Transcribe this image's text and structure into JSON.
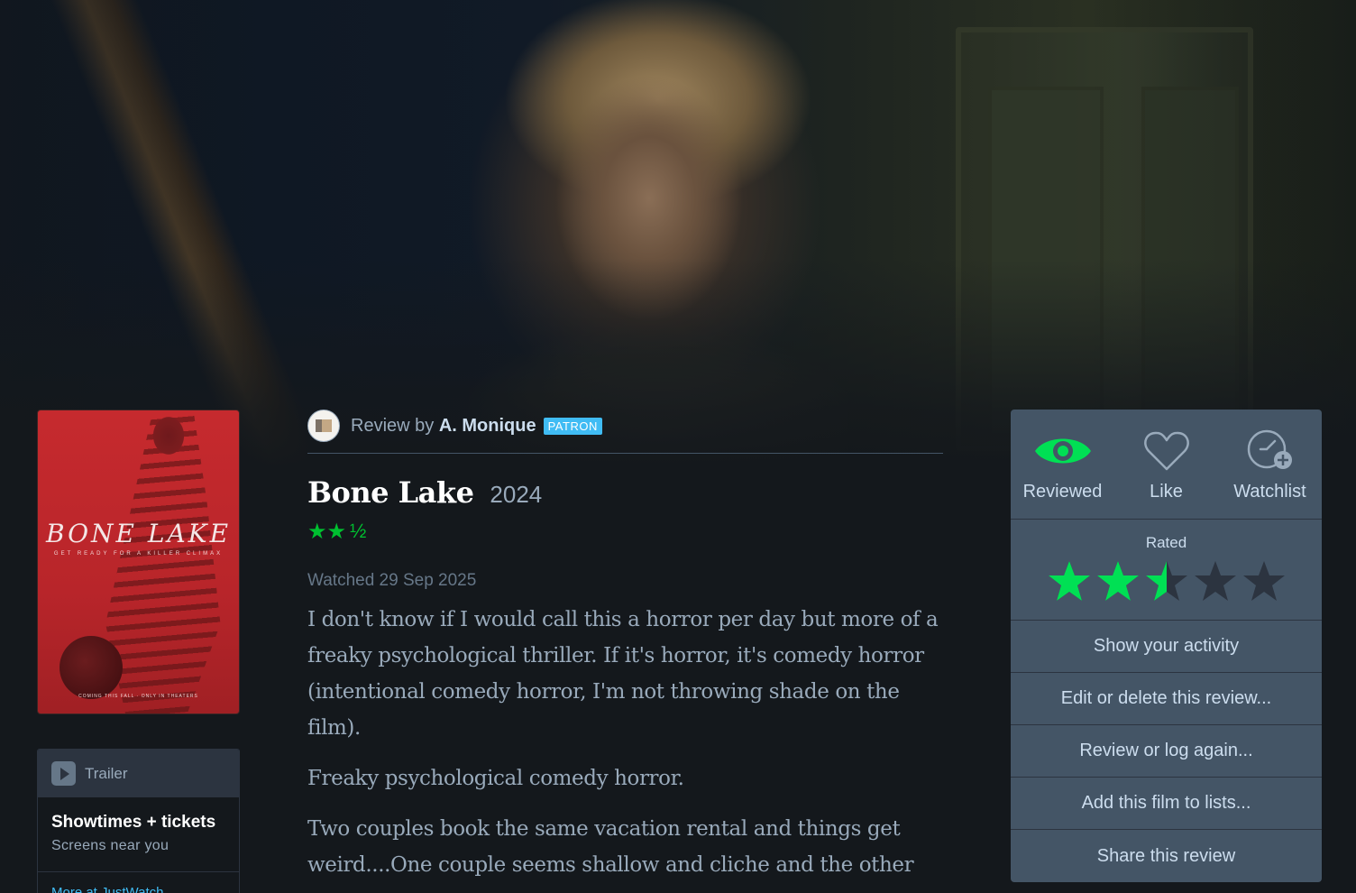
{
  "review": {
    "by_prefix": "Review by",
    "author": "A. Monique",
    "badge": "PATRON",
    "film_title": "Bone Lake",
    "film_year": "2024",
    "rating_stars": "★★",
    "rating_half": "½",
    "rating_value": 2.5,
    "watched": "Watched 29 Sep 2025",
    "paragraphs": [
      "I don't know if I would call this a horror per day but more of a freaky psychological thriller. If it's horror, it's comedy horror (intentional comedy horror, I'm not throwing shade on the film).",
      "Freaky psychological comedy horror.",
      "Two couples book the same vacation rental and things get weird....One couple seems shallow and cliche and the other"
    ]
  },
  "poster": {
    "title": "BONE LAKE",
    "tagline": "GET READY FOR A KILLER CLIMAX",
    "footer": "COMING THIS FALL · ONLY IN THEATERS"
  },
  "sidebar": {
    "trailer": "Trailer",
    "showtimes_title": "Showtimes + tickets",
    "showtimes_sub": "Screens near you",
    "more": "More at JustWatch"
  },
  "panel": {
    "actions": [
      {
        "label": "Reviewed",
        "icon": "eye-icon"
      },
      {
        "label": "Like",
        "icon": "heart-icon"
      },
      {
        "label": "Watchlist",
        "icon": "clock-plus-icon"
      }
    ],
    "rated_label": "Rated",
    "rating_value": 2.5,
    "rating_max": 5,
    "menu": [
      "Show your activity",
      "Edit or delete this review...",
      "Review or log again...",
      "Add this film to lists...",
      "Share this review"
    ]
  },
  "colors": {
    "background": "#14181c",
    "panel": "#445566",
    "accent_green": "#00e054",
    "star_green": "#00c030",
    "patron_blue": "#40bcf4"
  }
}
